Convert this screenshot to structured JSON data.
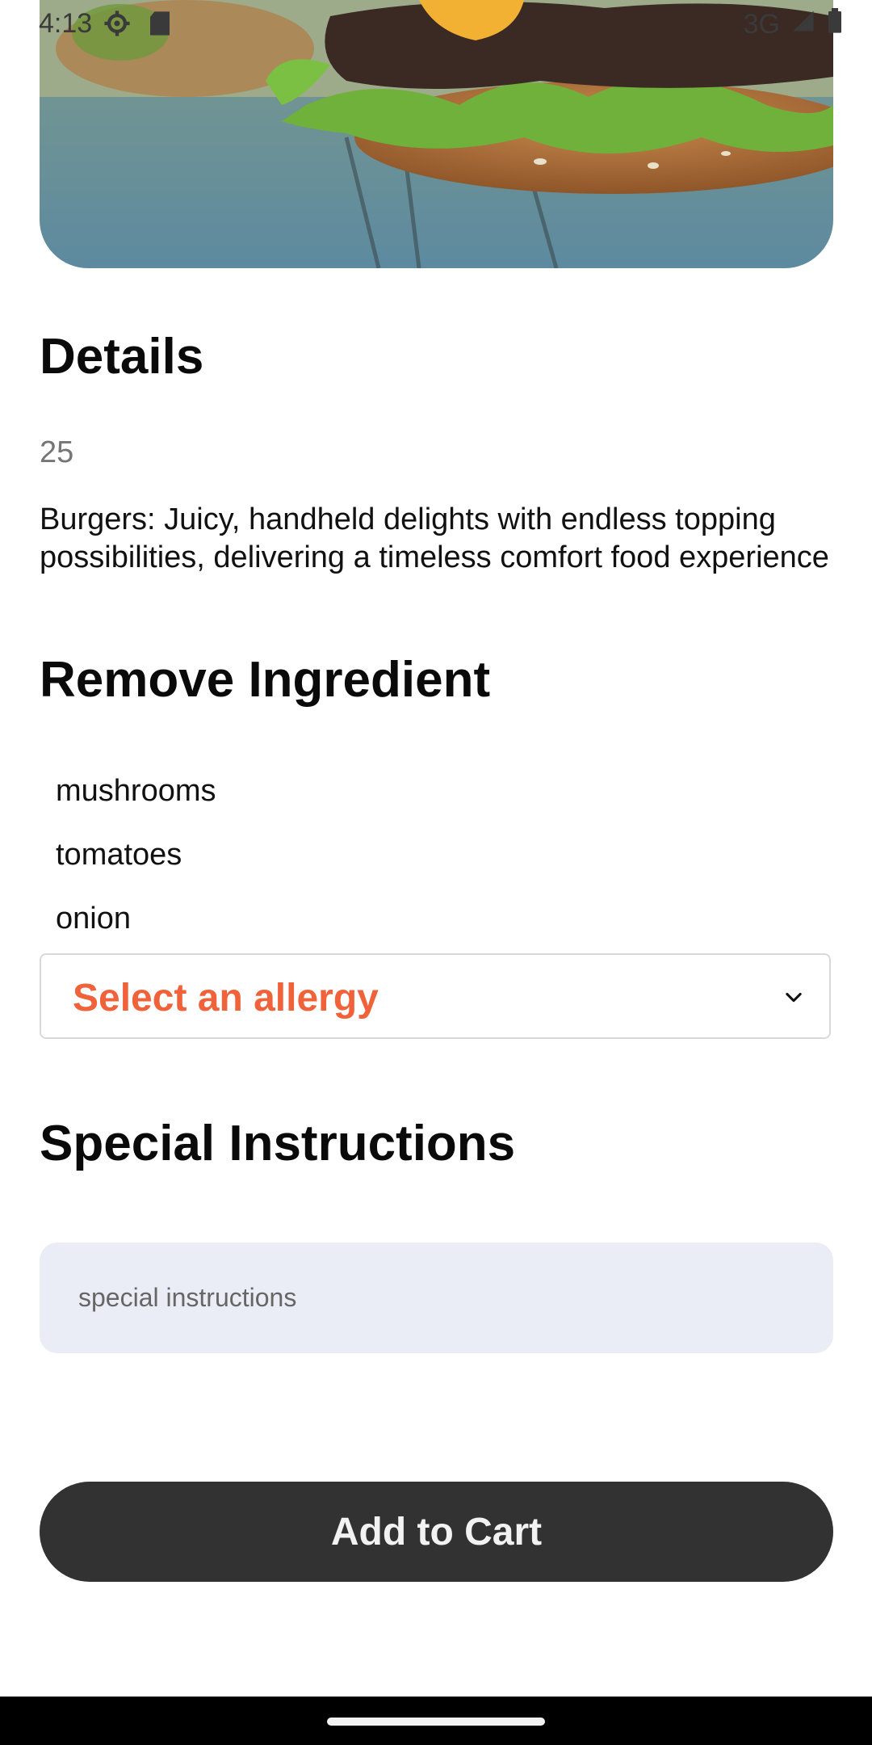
{
  "status_bar": {
    "time": "4:13",
    "network": "3G",
    "icons": [
      "settings-icon",
      "sd-card-icon",
      "signal-icon",
      "battery-icon"
    ]
  },
  "hero": {
    "image": "burger-photo"
  },
  "details": {
    "title": "Details",
    "price": "25",
    "description": "Burgers: Juicy, handheld delights with endless topping possibilities, delivering a timeless comfort food experience"
  },
  "remove_ingredient": {
    "title": "Remove Ingredient",
    "items": [
      "mushrooms",
      "tomatoes",
      "onion"
    ]
  },
  "allergy": {
    "label": "Select an allergy",
    "accent_color": "#f0623a"
  },
  "special_instructions": {
    "title": "Special Instructions",
    "placeholder": "special instructions"
  },
  "cart": {
    "button_label": "Add to Cart"
  }
}
